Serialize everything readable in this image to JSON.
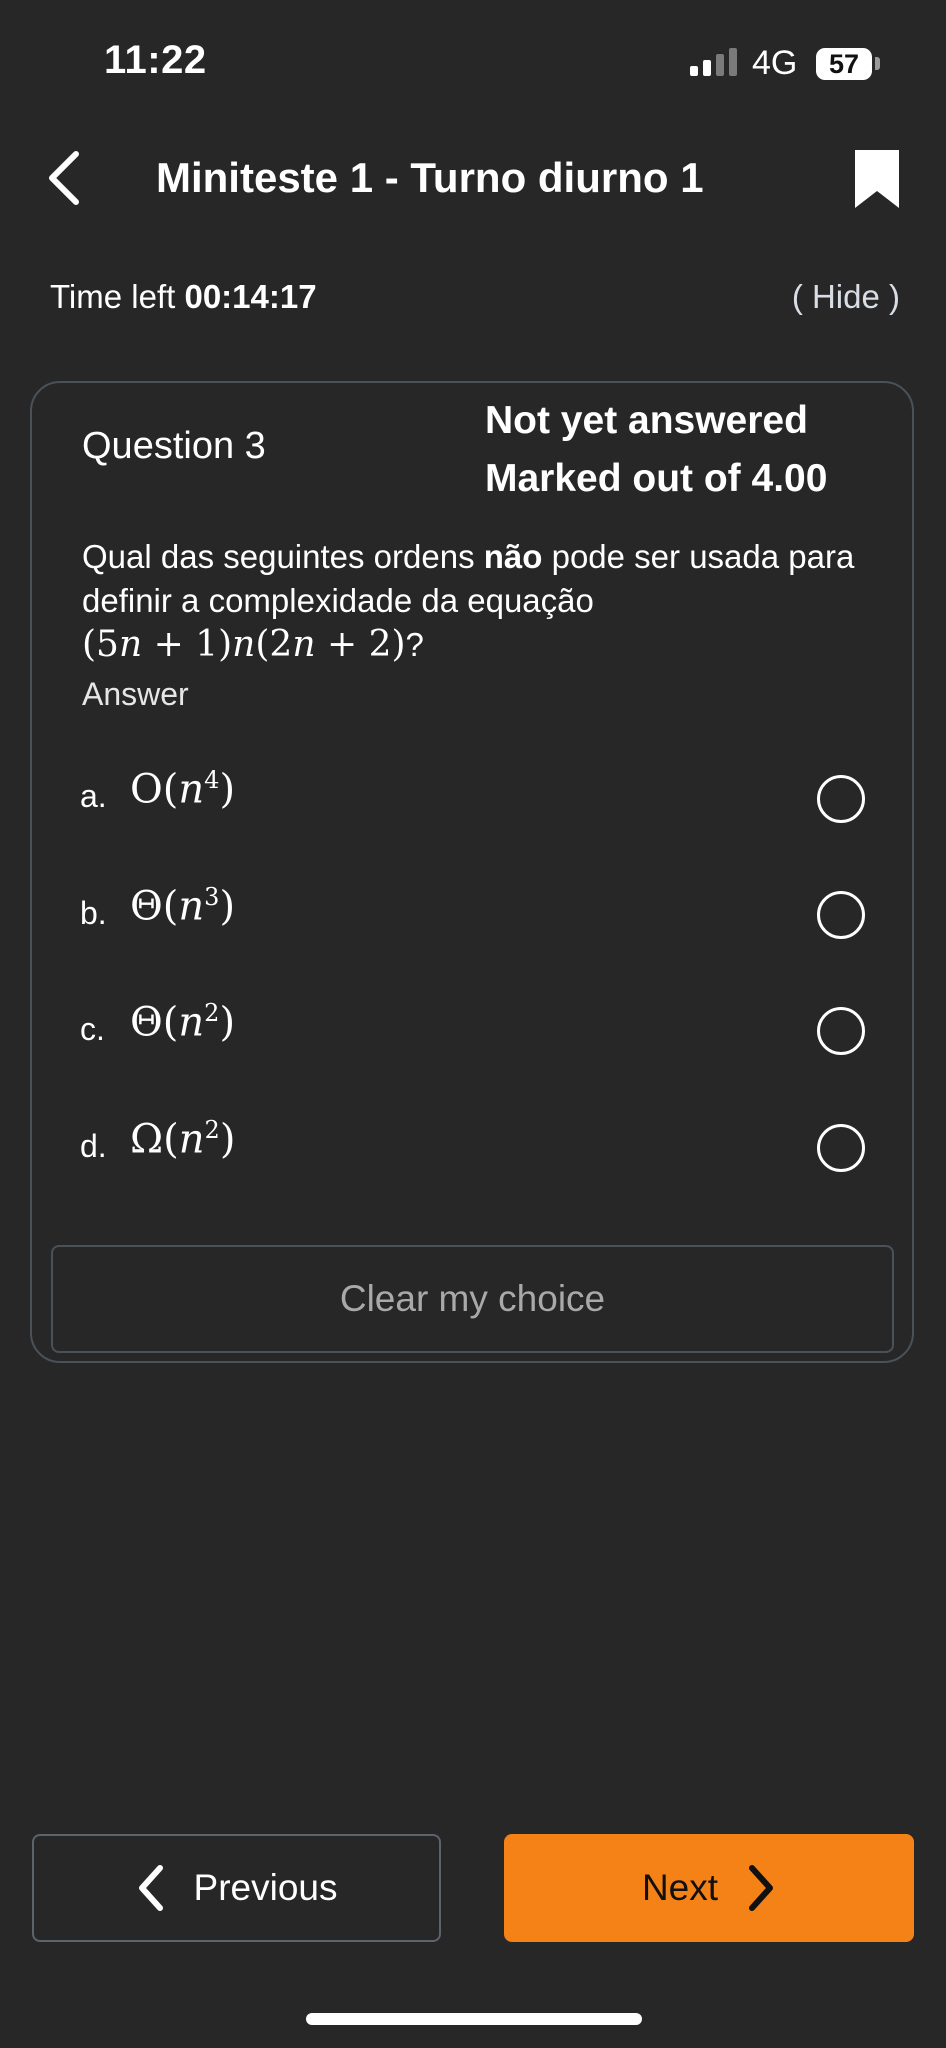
{
  "status_bar": {
    "time": "11:22",
    "network": "4G",
    "battery": "57"
  },
  "header": {
    "title": "Miniteste 1 - Turno diurno 1",
    "back_icon": "chevron-left-icon",
    "bookmark_icon": "bookmark-icon"
  },
  "timer": {
    "label": "Time left",
    "value": "00:14:17",
    "hide_label": "( Hide )"
  },
  "question": {
    "number_label": "Question 3",
    "status": "Not yet answered",
    "marks": "Marked out of 4.00",
    "text_before": "Qual das seguintes ordens ",
    "text_bold": "não",
    "text_after": " pode ser usada para definir a complexidade da equação",
    "equation": "(5n + 1)n(2n + 2)",
    "equation_suffix": "?",
    "answer_label": "Answer",
    "options": [
      {
        "letter": "a.",
        "func": "O",
        "var": "n",
        "exp": "4",
        "selected": false
      },
      {
        "letter": "b.",
        "func": "Θ",
        "var": "n",
        "exp": "3",
        "selected": false
      },
      {
        "letter": "c.",
        "func": "Θ",
        "var": "n",
        "exp": "2",
        "selected": false
      },
      {
        "letter": "d.",
        "func": "Ω",
        "var": "n",
        "exp": "2",
        "selected": false
      }
    ],
    "clear_label": "Clear my choice"
  },
  "navigation": {
    "previous_label": "Previous",
    "next_label": "Next"
  },
  "colors": {
    "background": "#272727",
    "accent": "#f58216",
    "border": "#4b5159"
  }
}
